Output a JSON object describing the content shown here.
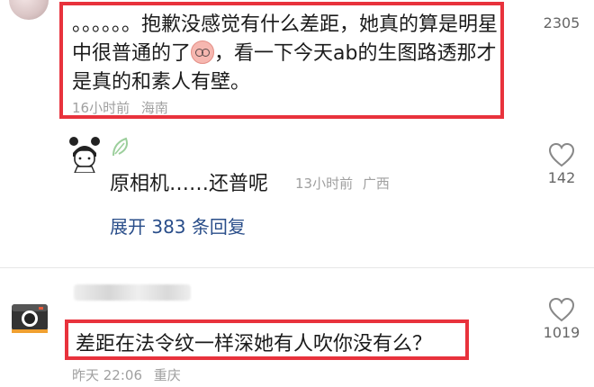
{
  "top_comment": {
    "text": "。。。。。。抱歉没感觉有什么差距，她真的算是明星中很普通的了",
    "text_after_emoji": "，看一下今天ab的生图路透那才是真的和素人有壁。",
    "time": "16小时前",
    "location": "海南",
    "emoji_icon": "glasses-face-emoji",
    "likes": "2305"
  },
  "reply": {
    "text": "原相机……还普呢",
    "time": "13小时前",
    "location": "广西",
    "likes": "142",
    "expand_label": "展开 383 条回复"
  },
  "second_comment": {
    "text": "差距在法令纹一样深她有人吹你没有么？",
    "time": "昨天 22:06",
    "location": "重庆",
    "likes": "1019"
  },
  "colors": {
    "highlight_border": "#e8323c",
    "link": "#2a4e8a",
    "meta": "#a0a0a0"
  }
}
